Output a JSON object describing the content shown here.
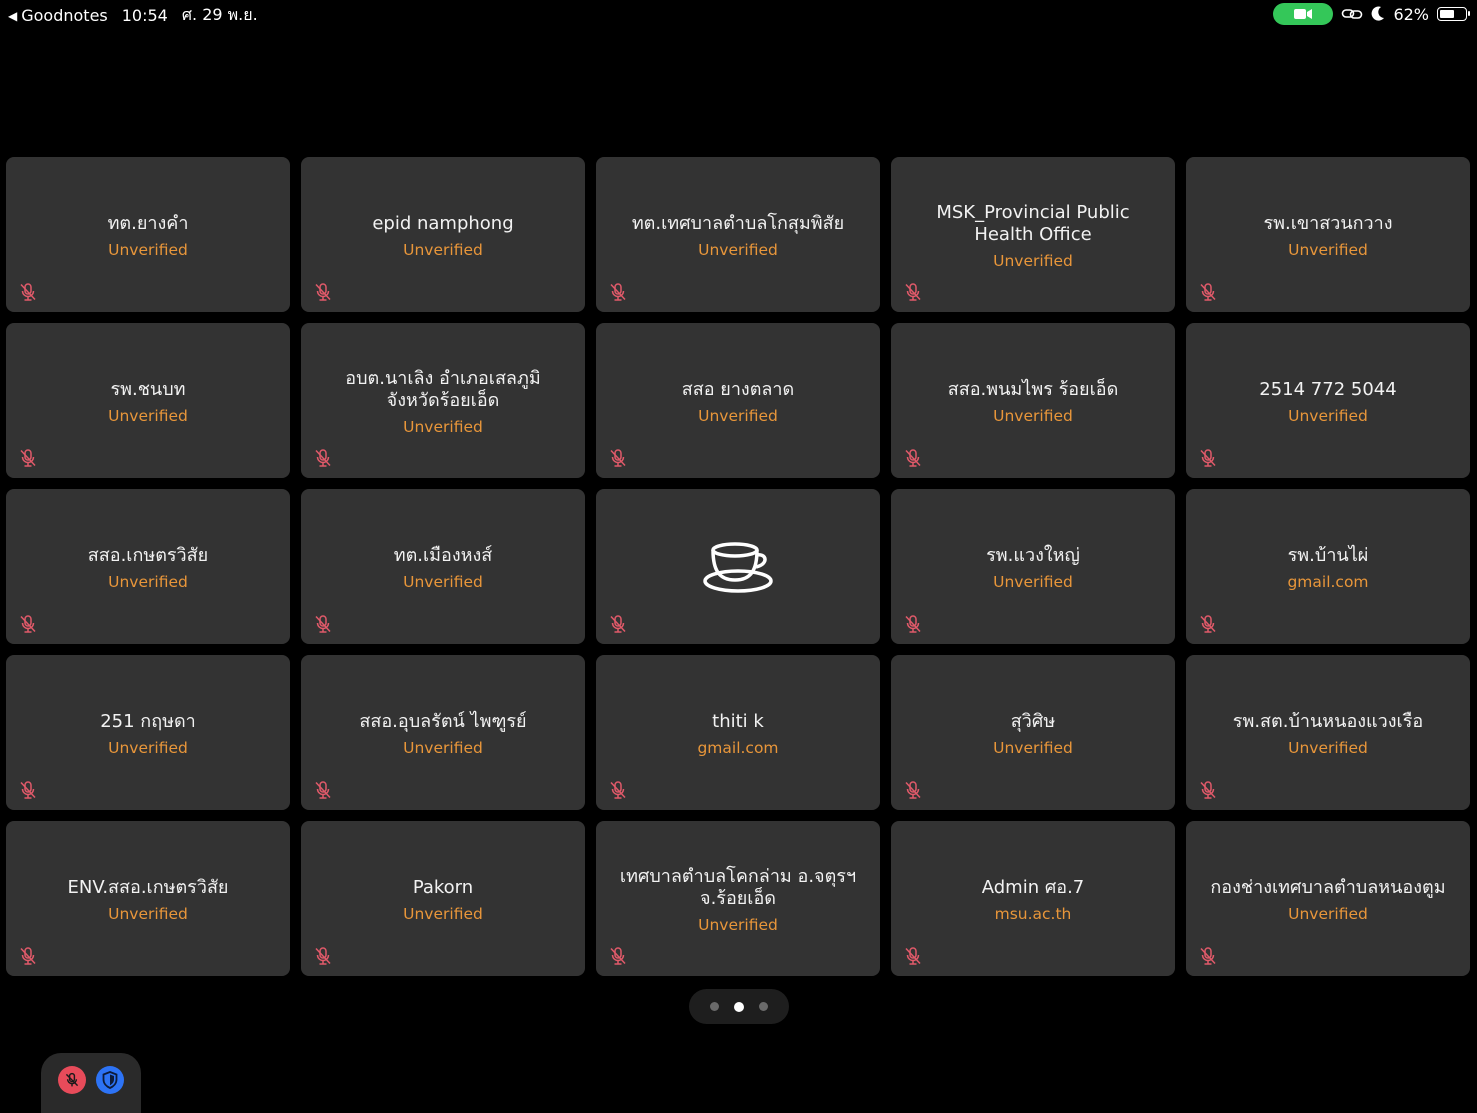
{
  "status_bar": {
    "back_app": "Goodnotes",
    "time": "10:54",
    "date": "ศ. 29 พ.ย.",
    "battery": "62%",
    "battery_level": 0.62
  },
  "tiles": [
    {
      "name": "ทต.ยางคำ",
      "status": "Unverified",
      "icon": "muted-mic-icon"
    },
    {
      "name": "epid namphong",
      "status": "Unverified",
      "icon": "muted-mic-icon"
    },
    {
      "name": "ทต.เทศบาลตำบลโกสุมพิสัย",
      "status": "Unverified",
      "icon": "muted-mic-icon"
    },
    {
      "name": "MSK_Provincial Public Health Office",
      "status": "Unverified",
      "icon": "muted-mic-icon"
    },
    {
      "name": "รพ.เขาสวนกวาง",
      "status": "Unverified",
      "icon": "muted-mic-icon"
    },
    {
      "name": "รพ.ชนบท",
      "status": "Unverified",
      "icon": "muted-mic-icon"
    },
    {
      "name": "อบต.นาเลิง อำเภอเสลภูมิ จังหวัดร้อยเอ็ด",
      "status": "Unverified",
      "icon": "muted-mic-icon"
    },
    {
      "name": "สสอ ยางตลาด",
      "status": "Unverified",
      "icon": "muted-mic-icon"
    },
    {
      "name": "สสอ.พนมไพร ร้อยเอ็ด",
      "status": "Unverified",
      "icon": "muted-mic-icon"
    },
    {
      "name": "2514 772 5044",
      "status": "Unverified",
      "icon": "muted-mic-icon"
    },
    {
      "name": "สสอ.เกษตรวิสัย",
      "status": "Unverified",
      "icon": "muted-mic-icon"
    },
    {
      "name": "ทต.เมืองหงส์",
      "status": "Unverified",
      "icon": "muted-mic-icon"
    },
    {
      "name": "",
      "status": "",
      "icon": "muted-mic-icon",
      "placeholder_icon": "coffee-cup-icon"
    },
    {
      "name": "รพ.แวงใหญ่",
      "status": "Unverified",
      "icon": "muted-mic-icon"
    },
    {
      "name": "รพ.บ้านไผ่",
      "status": "gmail.com",
      "icon": "muted-mic-icon"
    },
    {
      "name": "251 กฤษดา",
      "status": "Unverified",
      "icon": "muted-mic-icon"
    },
    {
      "name": "สสอ.อุบลรัตน์ ไพฑูรย์",
      "status": "Unverified",
      "icon": "muted-mic-icon"
    },
    {
      "name": "thiti k",
      "status": "gmail.com",
      "icon": "muted-mic-icon"
    },
    {
      "name": "สุวิศิษ",
      "status": "Unverified",
      "icon": "muted-mic-icon"
    },
    {
      "name": "รพ.สต.บ้านหนองแวงเรือ",
      "status": "Unverified",
      "icon": "muted-mic-icon"
    },
    {
      "name": "ENV.สสอ.เกษตรวิสัย",
      "status": "Unverified",
      "icon": "muted-mic-icon"
    },
    {
      "name": "Pakorn",
      "status": "Unverified",
      "icon": "muted-mic-icon"
    },
    {
      "name": "เทศบาลตำบลโคกล่าม อ.จตุรฯ จ.ร้อยเอ็ด",
      "status": "Unverified",
      "icon": "muted-mic-icon"
    },
    {
      "name": "Admin ศอ.7",
      "status": "msu.ac.th",
      "icon": "muted-mic-icon"
    },
    {
      "name": "กองช่างเทศบาลตำบลหนองตูม",
      "status": "Unverified",
      "icon": "muted-mic-icon"
    }
  ],
  "pager": {
    "pages": 3,
    "current": 2
  },
  "controls": [
    {
      "name": "unmute-button",
      "icon": "muted-mic-icon",
      "color": "#e74b5a"
    },
    {
      "name": "security-button",
      "icon": "shield-icon",
      "color": "#2d73f5"
    }
  ],
  "colors": {
    "background": "#000000",
    "tile": "#333333",
    "status_text": "#e8963a",
    "camera_pill": "#34c759"
  }
}
